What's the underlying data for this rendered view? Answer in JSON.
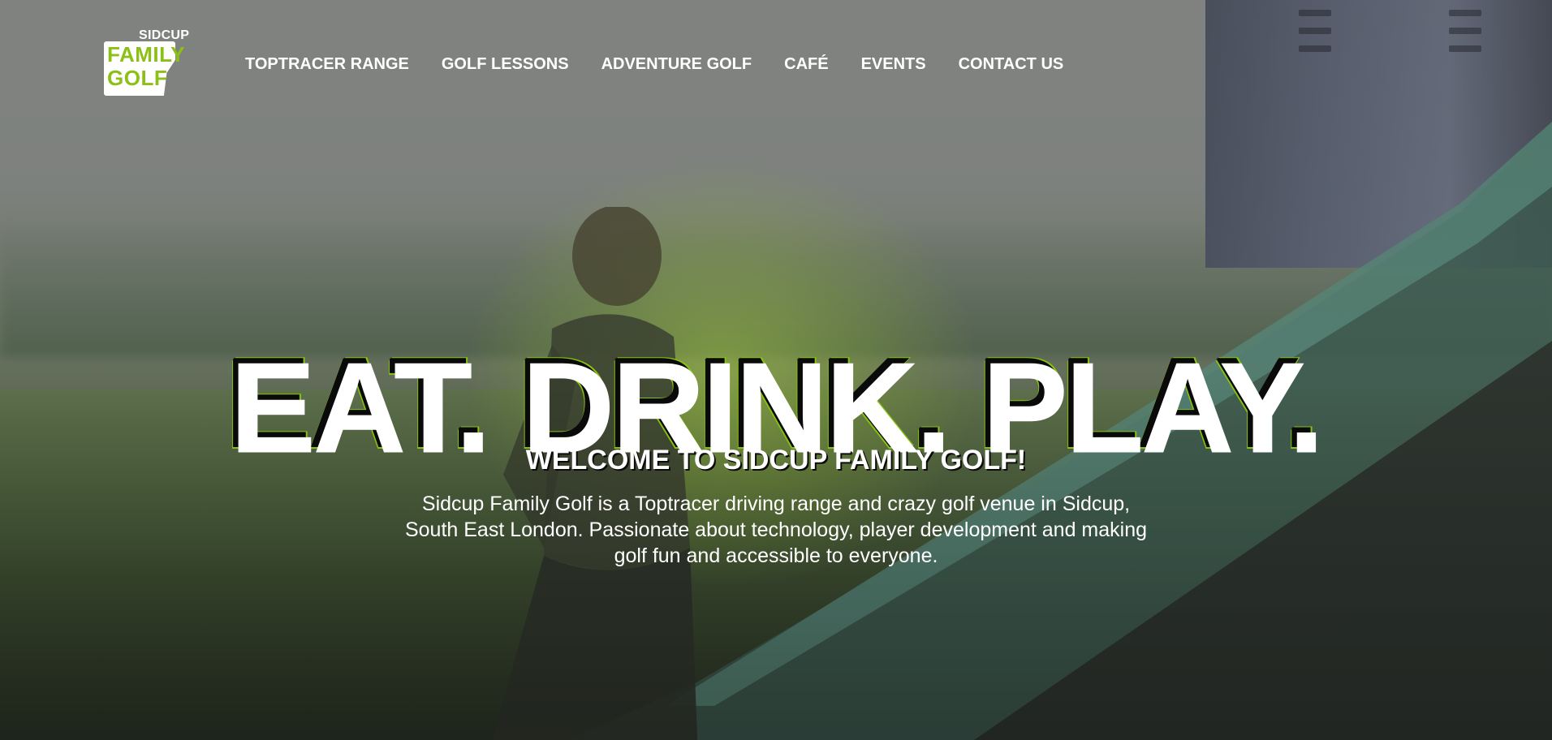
{
  "logo": {
    "top_text": "SIDCUP",
    "line1": "FAMILY",
    "line2": "GOLF"
  },
  "nav": {
    "items": [
      {
        "label": "TOPTRACER RANGE"
      },
      {
        "label": "GOLF LESSONS"
      },
      {
        "label": "ADVENTURE GOLF"
      },
      {
        "label": "CAFÉ"
      },
      {
        "label": "EVENTS"
      },
      {
        "label": "CONTACT US"
      }
    ]
  },
  "hero": {
    "headline": "EAT. DRINK. PLAY.",
    "subheading": "WELCOME TO SIDCUP FAMILY GOLF!",
    "intro": "Sidcup Family Golf is a Toptracer driving range and crazy golf venue in Sidcup, South East London. Passionate about technology, player development and making golf fun and accessible to everyone."
  },
  "colors": {
    "brand_green": "#8cc016",
    "text": "#ffffff"
  }
}
